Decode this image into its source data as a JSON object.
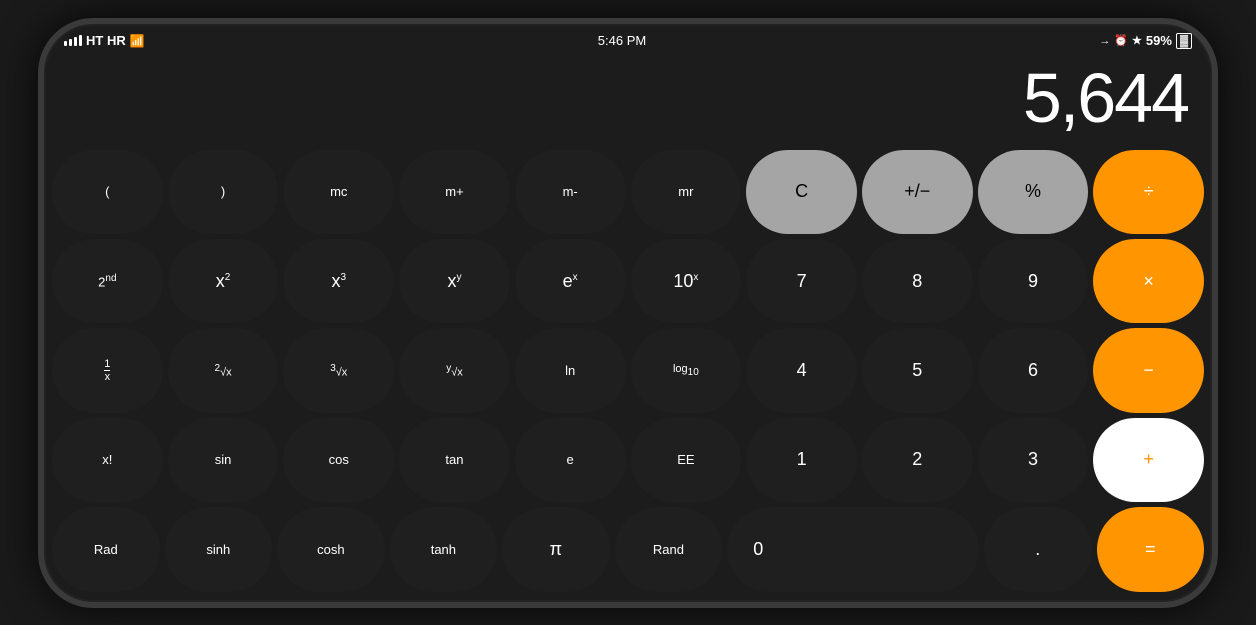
{
  "status": {
    "carrier": "HT HR",
    "time": "5:46 PM",
    "battery": "59%",
    "wifi": true
  },
  "display": {
    "value": "5,644"
  },
  "buttons": {
    "row1": [
      "(",
      ")",
      "mc",
      "m+",
      "m-",
      "mr",
      "C",
      "+/−",
      "%",
      "÷"
    ],
    "row2": [
      "2nd",
      "x²",
      "x³",
      "xʸ",
      "eˣ",
      "10ˣ",
      "7",
      "8",
      "9",
      "×"
    ],
    "row3": [
      "1/x",
      "²√x",
      "³√x",
      "ʸ√x",
      "ln",
      "log₁₀",
      "4",
      "5",
      "6",
      "−"
    ],
    "row4": [
      "x!",
      "sin",
      "cos",
      "tan",
      "e",
      "EE",
      "1",
      "2",
      "3",
      "+"
    ],
    "row5": [
      "Rad",
      "sinh",
      "cosh",
      "tanh",
      "π",
      "Rand",
      "0",
      ".",
      "="
    ]
  },
  "colors": {
    "dark_btn": "#333333",
    "orange": "#FF9500",
    "gray": "#a5a5a5",
    "white": "#ffffff"
  }
}
